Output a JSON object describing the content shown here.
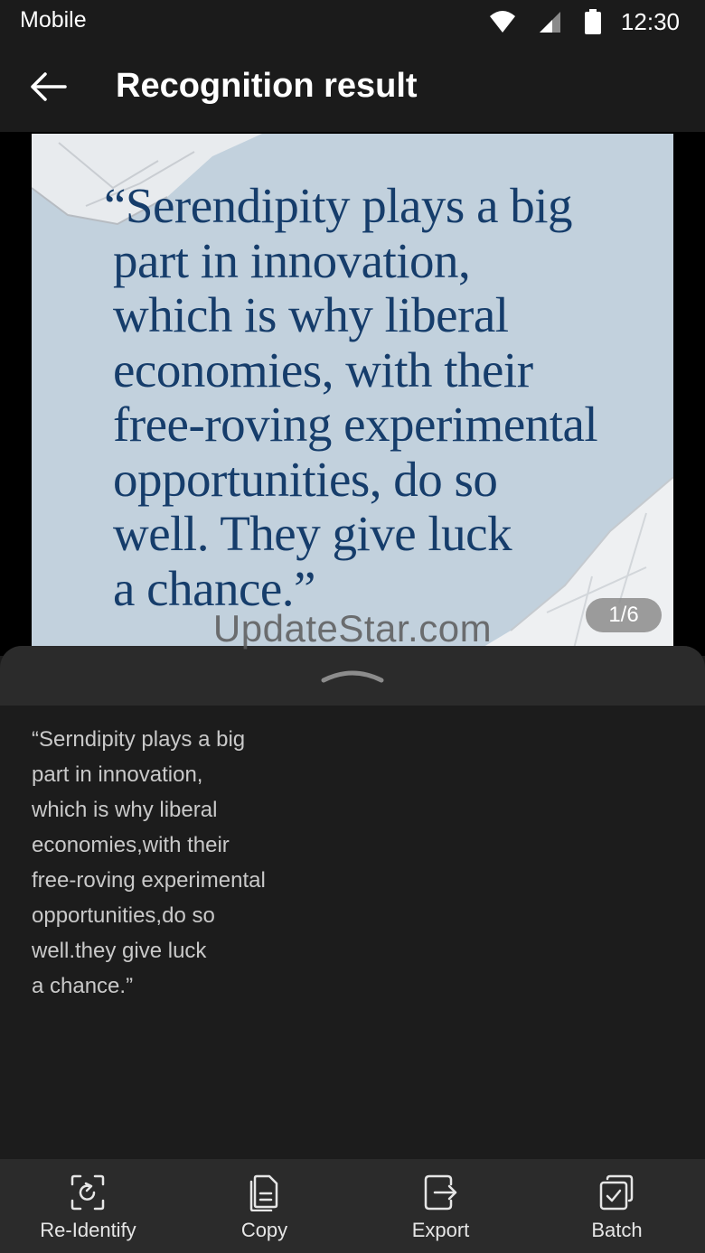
{
  "status_bar": {
    "carrier": "Mobile",
    "time": "12:30",
    "icons": [
      "wifi-icon",
      "signal-icon",
      "battery-icon"
    ]
  },
  "header": {
    "title": "Recognition result",
    "back_icon": "arrow-left-icon"
  },
  "image": {
    "quote_lines": [
      "“Serendipity plays a big",
      "part in innovation,",
      "which is why liberal",
      "economies, with their",
      "free-roving experimental",
      "opportunities, do so",
      "well. They give luck",
      "a chance.”"
    ],
    "page_indicator": "1/6",
    "watermark": "UpdateStar.com"
  },
  "result": {
    "handle_icon": "chevron-up-icon",
    "lines": [
      "“Serndipity plays a big",
      "part in innovation,",
      "which is why liberal",
      "economies,with their",
      "free-roving experimental",
      "opportunities,do so",
      "well.they give luck",
      "a chance.”"
    ]
  },
  "toolbar": {
    "items": [
      {
        "label": "Re-Identify",
        "icon": "re-identify-icon"
      },
      {
        "label": "Copy",
        "icon": "copy-document-icon"
      },
      {
        "label": "Export",
        "icon": "export-icon"
      },
      {
        "label": "Batch",
        "icon": "batch-check-icon"
      }
    ]
  },
  "colors": {
    "background": "#1b1b1b",
    "photo_background": "#c2d1dd",
    "quote_text": "#163d6b",
    "result_text": "#c9c9c9",
    "toolbar": "#2b2b2b"
  }
}
